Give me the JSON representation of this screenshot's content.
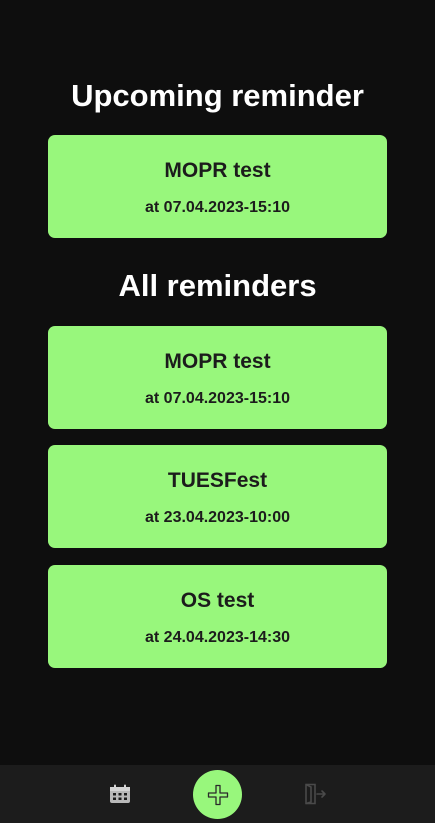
{
  "upcoming": {
    "heading": "Upcoming reminder",
    "reminder": {
      "title": "MOPR test",
      "time": "at 07.04.2023-15:10"
    }
  },
  "all": {
    "heading": "All reminders",
    "reminders": [
      {
        "title": "MOPR test",
        "time": "at 07.04.2023-15:10"
      },
      {
        "title": "TUESFest",
        "time": "at 23.04.2023-10:00"
      },
      {
        "title": "OS test",
        "time": "at 24.04.2023-14:30"
      }
    ]
  },
  "nav": {
    "calendar_icon": "calendar-icon",
    "add_icon": "plus-icon",
    "logout_icon": "logout-icon"
  },
  "colors": {
    "background": "#0e0e0e",
    "card": "#98f77c",
    "nav_bar": "#1c1c1c",
    "heading_text": "#ffffff",
    "card_text": "#1c1c1c"
  }
}
